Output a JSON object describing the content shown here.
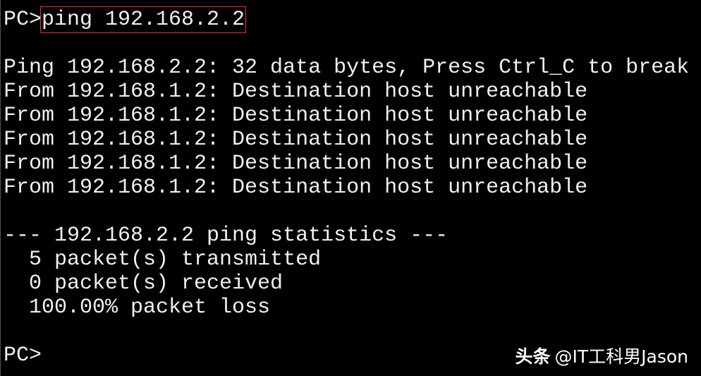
{
  "terminal": {
    "prompt": "PC>",
    "command": "ping 192.168.2.2",
    "output": [
      "",
      "Ping 192.168.2.2: 32 data bytes, Press Ctrl_C to break",
      "From 192.168.1.2: Destination host unreachable",
      "From 192.168.1.2: Destination host unreachable",
      "From 192.168.1.2: Destination host unreachable",
      "From 192.168.1.2: Destination host unreachable",
      "From 192.168.1.2: Destination host unreachable",
      "",
      "--- 192.168.2.2 ping statistics ---",
      "  5 packet(s) transmitted",
      "  0 packet(s) received",
      "  100.00% packet loss",
      ""
    ],
    "final_prompt": "PC>"
  },
  "watermark": {
    "brand": "头条",
    "handle": "@IT工科男Jason"
  },
  "colors": {
    "background": "#000000",
    "text": "#f0f0f0",
    "highlight_box": "#e03030"
  }
}
